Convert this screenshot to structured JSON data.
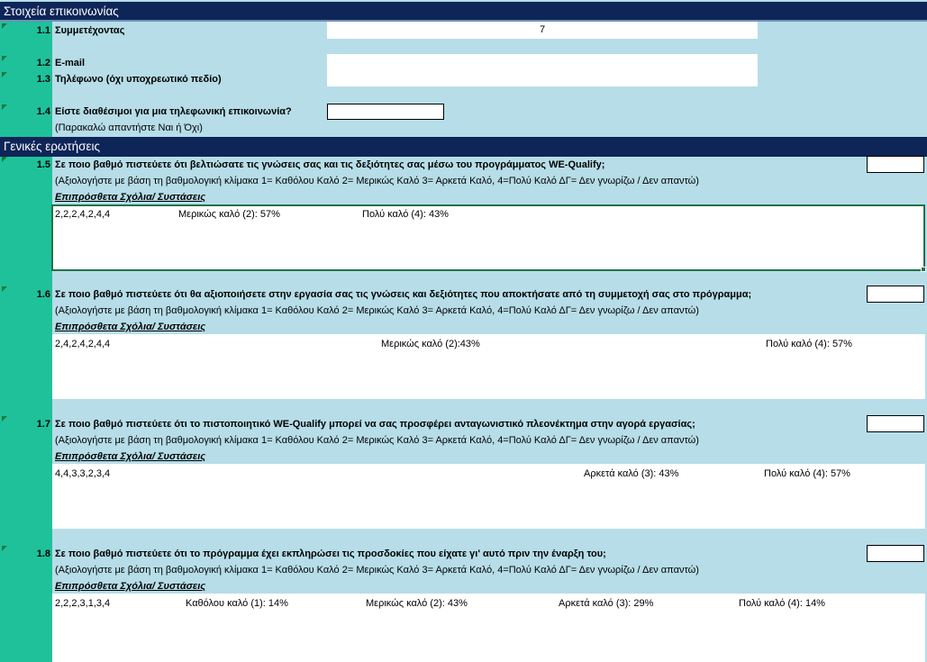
{
  "section1": {
    "title": "Στοιχεία επικοινωνίας",
    "rows": [
      {
        "num": "1.1",
        "label": "Συμμετέχοντας",
        "value": "7"
      },
      {
        "num": "1.2",
        "label": "E-mail",
        "value": ""
      },
      {
        "num": "1.3",
        "label": "Τηλέφωνο (όχι υποχρεωτικό πεδίο)",
        "value": ""
      },
      {
        "num": "1.4",
        "label": "Είστε διαθέσιμοι για μια τηλεφωνική επικοινωνία?",
        "hint": "(Παρακαλώ απαντήστε Ναι ή Όχι)",
        "value": ""
      }
    ]
  },
  "section2": {
    "title": "Γενικές ερωτήσεις",
    "comments_label": "Επιπρόσθετα Σχόλια/ Συστάσεις",
    "scale_hint": "(Αξιολογήστε με βάση τη βαθμολογική κλίμακα 1= Καθόλου Καλό 2= Μερικώς Καλό 3= Αρκετά Καλό, 4=Πολύ Καλό ΔΓ= Δεν γνωρίζω / Δεν απαντώ)",
    "questions": [
      {
        "num": "1.5",
        "text": "Σε ποιο βαθμό πιστεύετε ότι βελτιώσατε τις γνώσεις σας και τις δεξιότητες σας μέσω του προγράμματος WE-Qualify;",
        "comments": [
          "2,2,2,4,2,4,4",
          "Μερικώς καλό (2): 57%",
          "Πολύ καλό (4): 43%"
        ]
      },
      {
        "num": "1.6",
        "text": "Σε ποιο βαθμό πιστεύετε ότι θα αξιοποιήσετε στην εργασία σας τις γνώσεις και δεξιότητες που αποκτήσατε από τη συμμετοχή σας στο πρόγραμμα;",
        "comments": [
          "2,4,2,4,2,4,4",
          "Μερικώς καλό (2):43%",
          "Πολύ καλό (4): 57%"
        ]
      },
      {
        "num": "1.7",
        "text": "Σε ποιο βαθμό πιστεύετε ότι το πιστοποιητικό WE-Qualify μπορεί να σας προσφέρει ανταγωνιστικό πλεονέκτημα στην αγορά εργασίας;",
        "comments": [
          "4,4,3,3,2,3,4",
          "Αρκετά καλό (3): 43%",
          "Πολύ καλό (4): 57%"
        ]
      },
      {
        "num": "1.8",
        "text": "Σε ποιο βαθμό πιστεύετε ότι το πρόγραμμα έχει εκπληρώσει τις προσδοκίες που είχατε γι' αυτό πριν την έναρξη του;",
        "comments": [
          "2,2,2,3,1,3,4",
          "Καθόλου καλό (1): 14%",
          "Μερικώς καλό (2): 43%",
          "Αρκετά καλό (3): 29%",
          "Πολύ καλό (4): 14%"
        ]
      }
    ]
  }
}
